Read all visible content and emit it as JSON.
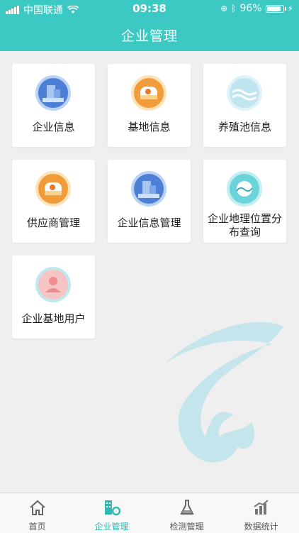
{
  "status_bar": {
    "carrier": "中国联通",
    "time": "09:38",
    "battery_percent": "96%",
    "battery_level": 0.96
  },
  "header": {
    "title": "企业管理"
  },
  "grid": [
    {
      "label": "企业信息",
      "icon": "building-icon",
      "color": "#4e7fd6"
    },
    {
      "label": "基地信息",
      "icon": "base-icon",
      "color": "#f19b3a"
    },
    {
      "label": "养殖池信息",
      "icon": "pond-icon",
      "color": "#bfe6f0"
    },
    {
      "label": "供应商管理",
      "icon": "supplier-icon",
      "color": "#f19b3a"
    },
    {
      "label": "企业信息管理",
      "icon": "building-manage-icon",
      "color": "#4e7fd6"
    },
    {
      "label": "企业地理位置分布查询",
      "icon": "location-icon",
      "color": "#6cd3da"
    },
    {
      "label": "企业基地用户",
      "icon": "user-icon",
      "color": "#f5c5c6"
    }
  ],
  "tabbar": {
    "items": [
      {
        "label": "首页",
        "icon": "home-icon",
        "active": false
      },
      {
        "label": "企业管理",
        "icon": "enterprise-icon",
        "active": true
      },
      {
        "label": "检测管理",
        "icon": "flask-icon",
        "active": false
      },
      {
        "label": "数据统计",
        "icon": "chart-icon",
        "active": false
      }
    ],
    "active_color": "#34b8b4"
  }
}
